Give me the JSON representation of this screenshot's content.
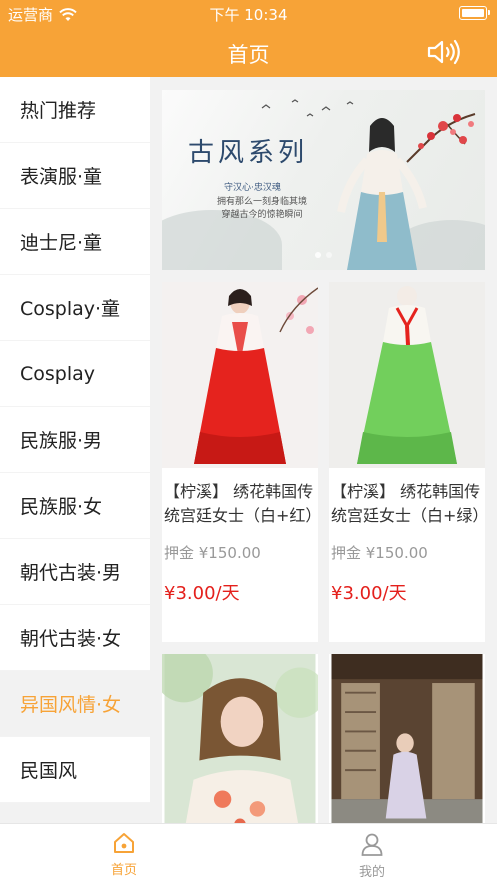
{
  "status": {
    "carrier": "运营商",
    "time": "下午 10:34"
  },
  "header": {
    "title": "首页"
  },
  "sidebar": {
    "items": [
      {
        "label": "热门推荐"
      },
      {
        "label": "表演服·童"
      },
      {
        "label": "迪士尼·童"
      },
      {
        "label": "Cosplay·童"
      },
      {
        "label": "Cosplay"
      },
      {
        "label": "民族服·男"
      },
      {
        "label": "民族服·女"
      },
      {
        "label": "朝代古装·男"
      },
      {
        "label": "朝代古装·女"
      },
      {
        "label": "异国风情·女"
      },
      {
        "label": "民国风"
      }
    ],
    "active_label": "异国风情·女"
  },
  "banner": {
    "title": "古风系列",
    "subtitle": "守汉心·忠汉魂",
    "text_line1": "拥有那么一刻身临其境",
    "text_line2": "穿越古今的惊艳瞬间"
  },
  "products": [
    {
      "name": "【柠溪】 绣花韩国传统宫廷女士（白+红）",
      "deposit": "押金 ¥150.00",
      "price": "¥3.00/天",
      "skirt_color": "#e5231e"
    },
    {
      "name": "【柠溪】 绣花韩国传统宫廷女士（白+绿）",
      "deposit": "押金 ¥150.00",
      "price": "¥3.00/天",
      "skirt_color": "#72cf5c"
    }
  ],
  "tabbar": {
    "home_label": "首页",
    "mine_label": "我的",
    "active_color": "#f7a337",
    "inactive_color": "#999999"
  },
  "colors": {
    "accent": "#f7a337",
    "price": "#e4201c"
  }
}
